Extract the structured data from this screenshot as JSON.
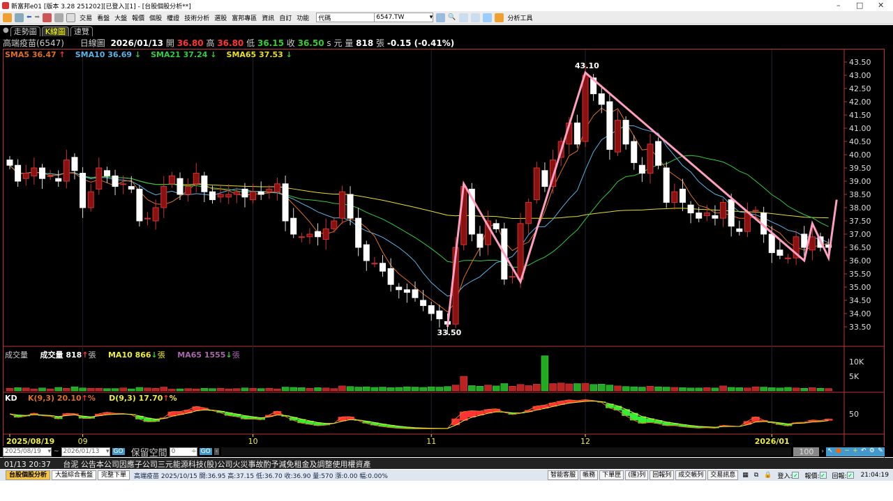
{
  "window": {
    "title": "新富邦e01 [版本 3.28 251202][已登入][1] - [台股個股分析**]"
  },
  "toolbar": {
    "menus": [
      "交易",
      "看盤",
      "大盤",
      "報價",
      "個股",
      "權證",
      "技術分析",
      "選股",
      "富邦專區",
      "資訊",
      "自訂",
      "功能"
    ],
    "code_label": "代碼",
    "code_value": "6547.TW",
    "tools_label": "分析工具"
  },
  "tabs": [
    "走勢圖",
    "K線圖",
    "速覽"
  ],
  "info": {
    "stock": "高端疫苗(6547)",
    "period": "日線圖",
    "date": "2026/01/13",
    "open_label": "開",
    "open": "36.80",
    "high_label": "高",
    "high": "36.80",
    "low_label": "低",
    "low": "36.15",
    "close_label": "收",
    "close": "36.50",
    "unit": "s 元",
    "vol_label": "量",
    "vol": "818",
    "vol_unit": "張",
    "change": "-0.15 (-0.41%)"
  },
  "ma_legend": [
    {
      "label": "SMA5 36.47",
      "arrow": "↑",
      "color": "#e07020"
    },
    {
      "label": "SMA10 36.69",
      "arrow": "↓",
      "color": "#5ab4e8"
    },
    {
      "label": "SMA21 37.24",
      "arrow": "↓",
      "color": "#2ecc40"
    },
    {
      "label": "SMA65 37.53",
      "arrow": "↓",
      "color": "#e8e020"
    }
  ],
  "vol_legend": {
    "title": "成交量",
    "vol_label": "成交量 818",
    "vol_arrow": "↑",
    "unit": "張",
    "ma10": "MA10 866",
    "ma10_arrow": "↓",
    "ma65": "MA65 1555",
    "ma65_arrow": "↓"
  },
  "kd_legend": {
    "title": "KD",
    "k": "K(9,3) 20.10",
    "k_arrow": "↑",
    "d": "D(9,3) 17.70",
    "d_arrow": "↑",
    "pct": "%"
  },
  "colors": {
    "up": "#8b1010",
    "down": "#ffffff",
    "zigzag": "#ff9ec0"
  },
  "chart_data": {
    "type": "candlestick",
    "price_ticks": [
      "43.50",
      "43.00",
      "42.50",
      "42.00",
      "41.50",
      "41.00",
      "40.50",
      "40.00",
      "39.50",
      "39.00",
      "38.50",
      "38.00",
      "37.50",
      "37.00",
      "36.50",
      "36.00",
      "35.50",
      "35.00",
      "34.50",
      "34.00",
      "33.50"
    ],
    "ylim": [
      33.5,
      43.5
    ],
    "closes": [
      39.6,
      39.0,
      39.3,
      39.5,
      39.1,
      39.2,
      39.0,
      39.8,
      39.4,
      38.0,
      38.6,
      39.5,
      39.2,
      38.8,
      38.9,
      38.7,
      37.5,
      37.6,
      38.0,
      38.8,
      39.2,
      38.5,
      38.8,
      39.3,
      38.6,
      38.3,
      38.5,
      38.5,
      38.6,
      38.4,
      38.6,
      38.5,
      38.7,
      38.9,
      37.5,
      37.0,
      36.9,
      37.0,
      36.9,
      37.2,
      37.5,
      38.6,
      37.6,
      36.5,
      36.0,
      35.9,
      35.6,
      35.1,
      34.9,
      34.8,
      34.6,
      34.3,
      34.0,
      33.8,
      33.6,
      36.5,
      38.8,
      37.0,
      36.5,
      37.5,
      37.2,
      35.3,
      35.4,
      37.4,
      38.2,
      39.5,
      38.8,
      39.8,
      40.5,
      41.2,
      40.4,
      43.0,
      42.3,
      41.9,
      40.2,
      41.3,
      40.4,
      39.7,
      39.3,
      40.4,
      39.6,
      38.2,
      38.6,
      38.2,
      37.8,
      37.6,
      37.8,
      37.6,
      38.2,
      37.3,
      37.1,
      37.8,
      37.9,
      37.0,
      36.3,
      36.2,
      36.1,
      36.9,
      36.5,
      36.9,
      36.5,
      36.5
    ],
    "volumes": [
      900,
      1100,
      1000,
      700,
      1000,
      700,
      1200,
      900,
      1400,
      1000,
      900,
      900,
      800,
      800,
      1000,
      700,
      1200,
      1000,
      900,
      1300,
      600,
      700,
      800,
      700,
      900,
      800,
      900,
      700,
      800,
      1000,
      900,
      800,
      900,
      700,
      1300,
      1200,
      1100,
      900,
      1100,
      1000,
      800,
      1700,
      1500,
      1300,
      1400,
      1200,
      1300,
      1100,
      1200,
      1400,
      1300,
      1200,
      1400,
      1300,
      1500,
      2000,
      5000,
      1800,
      1600,
      2000,
      1700,
      2500,
      1600,
      2200,
      1800,
      2300,
      12000,
      2500,
      2700,
      2400,
      2500,
      2600,
      2200,
      2300,
      2000,
      1700,
      1500,
      1400,
      1300,
      1600,
      1400,
      1300,
      1200,
      1100,
      1000,
      1000,
      1100,
      1000,
      1700,
      1200,
      1100,
      1000,
      1400,
      1300,
      1100,
      1000,
      1200,
      1000,
      900,
      1100,
      900,
      818
    ],
    "vol_ticks": [
      "10K",
      "5K"
    ],
    "kd_ticks": [
      "50"
    ],
    "zigzag": [
      [
        54,
        33.5
      ],
      [
        56,
        38.9
      ],
      [
        63,
        35.2
      ],
      [
        71,
        43.1
      ],
      [
        98,
        36.0
      ],
      [
        99,
        37.4
      ],
      [
        101,
        36.1
      ],
      [
        102,
        38.3
      ]
    ],
    "annotations": [
      {
        "index": 71,
        "text": "43.10"
      },
      {
        "index": 54,
        "text": "33.50"
      }
    ],
    "x_labels": [
      {
        "index": 0,
        "text": "2025/08/19"
      },
      {
        "index": 9,
        "text": "09"
      },
      {
        "index": 30,
        "text": "10"
      },
      {
        "index": 52,
        "text": "11"
      },
      {
        "index": 71,
        "text": "12"
      },
      {
        "index": 94,
        "text": "2026/01"
      }
    ]
  },
  "controls": {
    "from": "2025/08/19",
    "to": "2026/01/13",
    "go": "GO",
    "reserve_label": "保留空間",
    "reserve_value": "0",
    "zoom": "100"
  },
  "news": {
    "time": "01/13 20:37",
    "text": "台泥 公告本公司因應子公司三元能源科技(股)公司火災事故酌予減免租金及調整使用權資產"
  },
  "status": {
    "tabs": [
      "台股個股分析",
      "大盤綜合看盤",
      "完整下單"
    ],
    "quote": "高端疫苗 2025/10/15 開:36.95 高:37.15 低:36.70 收:36.90 量:570 漲:0.00 幅:0.00%",
    "buttons": [
      "智能客服",
      "帳務",
      "下單匣",
      "(匯)列",
      "回報列",
      "成交帳列",
      "交易訊息"
    ],
    "login": "登入:",
    "quote_lbl": "報價:",
    "reply_lbl": "回報:",
    "clock": "21:04:19"
  }
}
